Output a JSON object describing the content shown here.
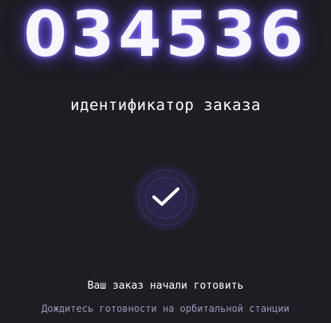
{
  "order": {
    "id": "034536",
    "caption": "идентификатор заказа"
  },
  "status": {
    "icon": "check-icon",
    "title": "Ваш заказ начали готовить",
    "hint": "Дождитесь готовности на орбитальной станции"
  },
  "colors": {
    "background": "#1d1d23",
    "glow": "#6e5aff",
    "hint_text": "#9a96b8",
    "badge": "#2e2852"
  }
}
